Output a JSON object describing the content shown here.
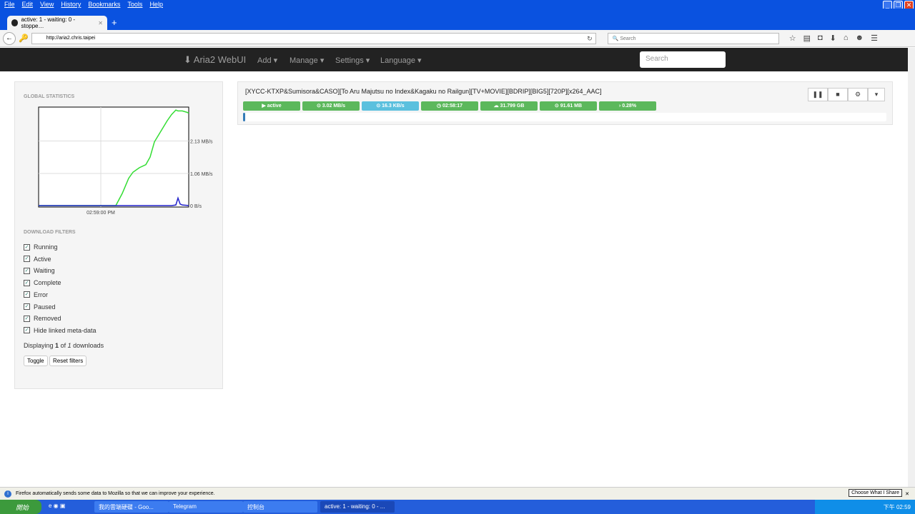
{
  "browser": {
    "menu": [
      "File",
      "Edit",
      "View",
      "History",
      "Bookmarks",
      "Tools",
      "Help"
    ],
    "tab_title": "active: 1 - waiting: 0 - stoppe…",
    "url": "http://aria2.chris.taipei",
    "search_placeholder": "Search"
  },
  "app": {
    "brand": "Aria2 WebUI",
    "nav": [
      "Add",
      "Manage",
      "Settings",
      "Language"
    ],
    "search_placeholder": "Search"
  },
  "sidebar": {
    "global_stats_heading": "GLOBAL STATISTICS",
    "filters_heading": "DOWNLOAD FILTERS",
    "filters": [
      "Running",
      "Active",
      "Waiting",
      "Complete",
      "Error",
      "Paused",
      "Removed",
      "Hide linked meta-data"
    ],
    "displaying_prefix": "Displaying",
    "displaying_count": "1",
    "displaying_of": "of",
    "displaying_total": "1",
    "displaying_suffix": "downloads",
    "toggle_label": "Toggle",
    "reset_label": "Reset filters"
  },
  "chart_data": {
    "type": "line",
    "title": "GLOBAL STATISTICS",
    "x_tick_labels": [
      "02:59:00 PM"
    ],
    "x_tick_seconds": [
      29
    ],
    "y_tick_labels": [
      "0 B/s",
      "1.06 MB/s",
      "2.13 MB/s"
    ],
    "y_ticks": [
      0,
      1.06,
      2.13
    ],
    "ylim": [
      0,
      3.2
    ],
    "xlim": [
      0,
      70
    ],
    "unit": "MB/s",
    "x": [
      0,
      36,
      39,
      42,
      44,
      47,
      50,
      52,
      54,
      57,
      60,
      62,
      64,
      65,
      66,
      67,
      69,
      70
    ],
    "series": [
      {
        "name": "download",
        "color": "#33dd33",
        "values": [
          0,
          0,
          0.4,
          0.9,
          1.1,
          1.25,
          1.35,
          1.6,
          2.1,
          2.45,
          2.8,
          3.0,
          3.15,
          3.12,
          3.12,
          3.12,
          3.08,
          3.05
        ]
      },
      {
        "name": "upload",
        "color": "#2222cc",
        "values": [
          0,
          0,
          0,
          0,
          0,
          0,
          0,
          0,
          0,
          0,
          0,
          0,
          0.02,
          0.25,
          0.05,
          0.02,
          0.01,
          0
        ]
      }
    ]
  },
  "download": {
    "name": "[XYCC-KTXP&Sumisora&CASO][To Aru Majutsu no Index&Kagaku no Railgun][TV+MOVIE][BDRIP][BIG5][720P][x264_AAC]",
    "status": "active",
    "download_speed": "3.02 MB/s",
    "upload_speed": "16.3 KB/s",
    "eta": "02:58:17",
    "size": "31.799 GB",
    "downloaded": "91.61 MB",
    "progress": "0.28%",
    "progress_fraction": 0.0028
  },
  "notification": {
    "text": "Firefox automatically sends some data to Mozilla so that we can improve your experience.",
    "button": "Choose What I Share"
  },
  "taskbar": {
    "start": "開始",
    "tasks": [
      "我的雲端硬碟 - Goo...",
      "Telegram",
      "控制台",
      "active: 1 - waiting: 0 - ..."
    ],
    "clock": "下午 02:59"
  }
}
